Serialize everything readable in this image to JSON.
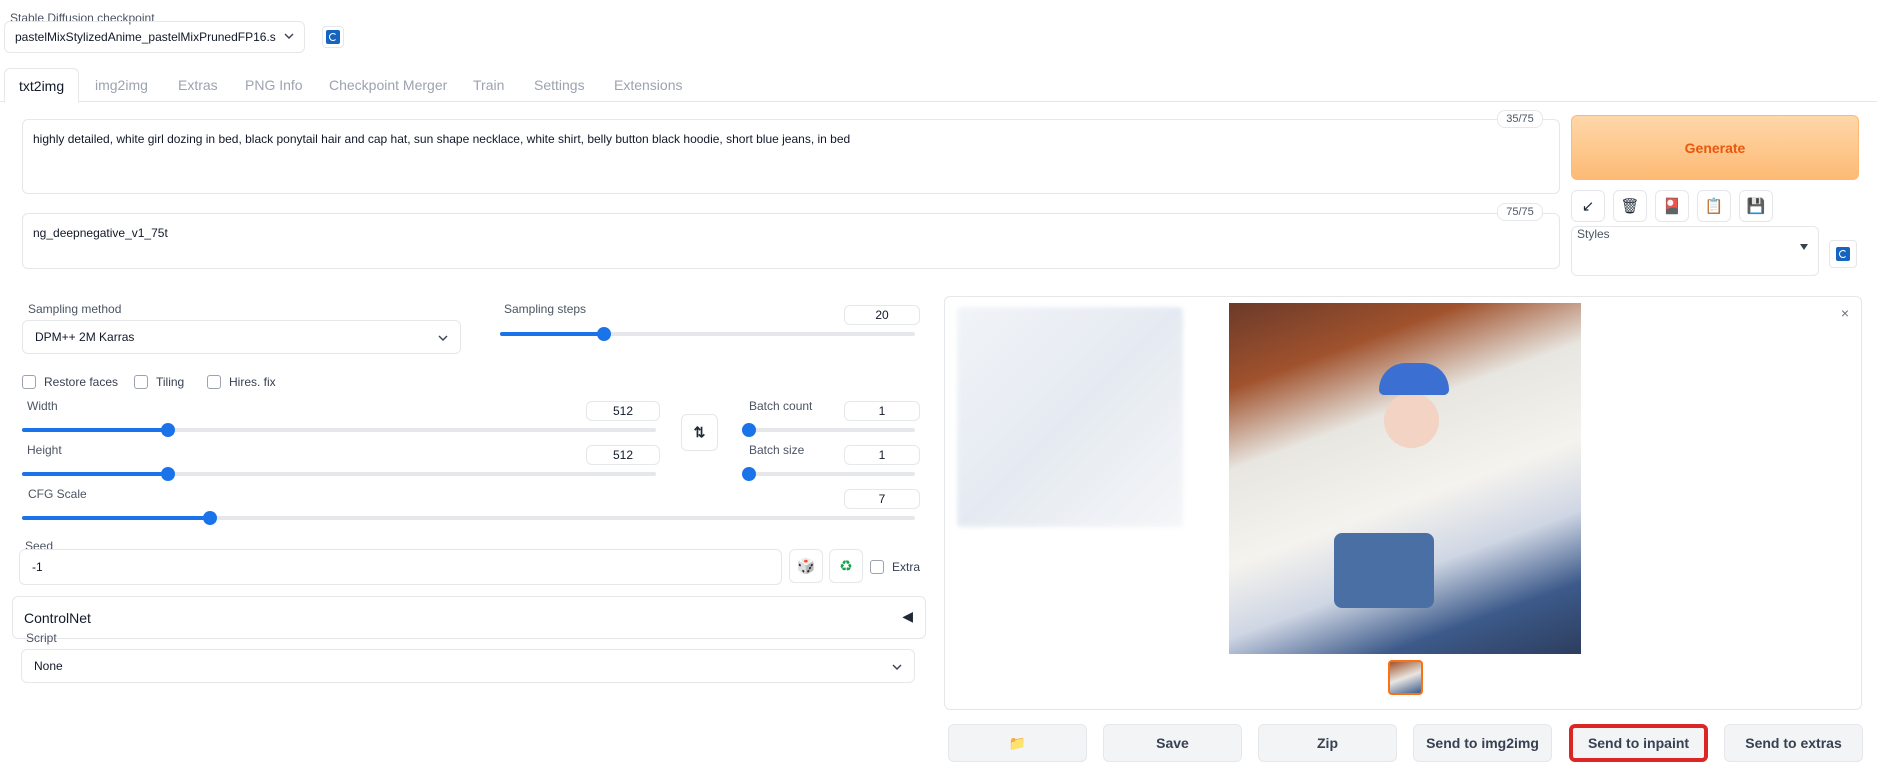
{
  "checkpoint": {
    "label": "Stable Diffusion checkpoint",
    "value": "pastelMixStylizedAnime_pastelMixPrunedFP16.s"
  },
  "tabs": [
    "txt2img",
    "img2img",
    "Extras",
    "PNG Info",
    "Checkpoint Merger",
    "Train",
    "Settings",
    "Extensions"
  ],
  "prompt": {
    "positive": "highly detailed, white girl dozing in bed, black ponytail hair and cap hat, sun shape necklace, white shirt, belly button black hoodie, short blue jeans, in bed",
    "positive_count": "35/75",
    "negative": "ng_deepnegative_v1_75t",
    "negative_count": "75/75"
  },
  "generate_label": "Generate",
  "styles_label": "Styles",
  "sampling": {
    "method_label": "Sampling method",
    "method_value": "DPM++ 2M Karras",
    "steps_label": "Sampling steps",
    "steps_value": "20",
    "steps_fraction": 0.25
  },
  "checkboxes": {
    "restore_faces": "Restore faces",
    "tiling": "Tiling",
    "hires_fix": "Hires. fix"
  },
  "width": {
    "label": "Width",
    "value": "512",
    "fraction": 0.23
  },
  "height": {
    "label": "Height",
    "value": "512",
    "fraction": 0.23
  },
  "batch_count": {
    "label": "Batch count",
    "value": "1",
    "fraction": 0.0
  },
  "batch_size": {
    "label": "Batch size",
    "value": "1",
    "fraction": 0.0
  },
  "cfg": {
    "label": "CFG Scale",
    "value": "7",
    "fraction": 0.21
  },
  "seed": {
    "label": "Seed",
    "value": "-1",
    "extra_label": "Extra"
  },
  "controlnet_label": "ControlNet",
  "script": {
    "label": "Script",
    "value": "None"
  },
  "output_buttons": {
    "save": "Save",
    "zip": "Zip",
    "send_img2img": "Send to img2img",
    "send_inpaint": "Send to inpaint",
    "send_extras": "Send to extras"
  },
  "colors": {
    "accent": "#1a73e8",
    "generate_bg": "#fdba74",
    "generate_text": "#ea580c",
    "highlight_border": "#dc2626"
  }
}
